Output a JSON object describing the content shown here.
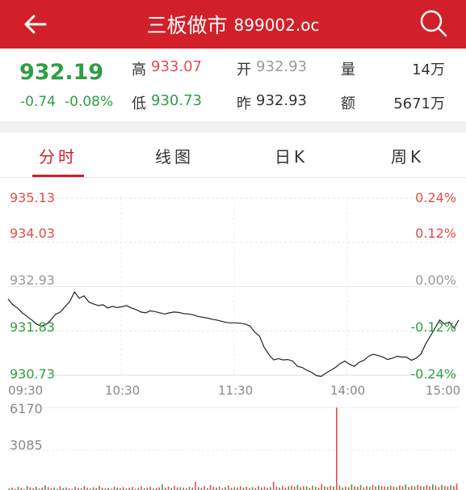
{
  "header": {
    "title": "三板做市",
    "code": "899002.oc"
  },
  "quote": {
    "price": "932.19",
    "change": "-0.74",
    "change_pct": "-0.08%",
    "high_label": "高",
    "high_value": "933.07",
    "low_label": "低",
    "low_value": "930.73",
    "open_label": "开",
    "open_value": "932.93",
    "prev_label": "昨",
    "prev_value": "932.93",
    "volume_label": "量",
    "volume_value": "14万",
    "amount_label": "额",
    "amount_value": "5671万"
  },
  "tabs": [
    "分时",
    "线图",
    "日K",
    "周K"
  ],
  "active_tab": 0,
  "chart_data": {
    "type": "line",
    "y_price_labels": [
      "935.13",
      "934.03",
      "932.93",
      "931.83",
      "930.73"
    ],
    "y_pct_labels": [
      "0.24%",
      "0.12%",
      "0.00%",
      "-0.12%",
      "-0.24%"
    ],
    "x_time_labels": [
      "09:30",
      "10:30",
      "11:30",
      "14:00",
      "15:00"
    ],
    "ylim": [
      930.73,
      935.13
    ],
    "prev_close": 932.93,
    "price_series": [
      932.62,
      932.48,
      932.4,
      932.28,
      932.19,
      932.1,
      932.0,
      931.95,
      931.99,
      932.1,
      932.24,
      932.3,
      932.43,
      932.56,
      932.8,
      932.64,
      932.7,
      932.55,
      932.5,
      932.46,
      932.48,
      932.4,
      932.44,
      932.41,
      932.43,
      932.46,
      932.4,
      932.36,
      932.3,
      932.28,
      932.33,
      932.31,
      932.28,
      932.25,
      932.28,
      932.3,
      932.29,
      932.26,
      932.25,
      932.23,
      932.19,
      932.17,
      932.15,
      932.12,
      932.1,
      932.07,
      932.04,
      932.03,
      932.03,
      932.02,
      932.0,
      931.95,
      931.8,
      931.7,
      931.42,
      931.24,
      931.11,
      931.14,
      931.11,
      931.12,
      931.08,
      930.95,
      930.92,
      930.85,
      930.8,
      930.72,
      930.7,
      930.78,
      930.85,
      930.92,
      931.02,
      931.08,
      931.0,
      930.95,
      931.05,
      931.1,
      931.2,
      931.25,
      931.22,
      931.18,
      931.12,
      931.15,
      931.2,
      931.18,
      931.18,
      931.1,
      931.15,
      931.25,
      931.5,
      931.7,
      931.9,
      932.1,
      932.0,
      932.05,
      931.9,
      932.1
    ],
    "volume_scale_labels": [
      "6170",
      "3085"
    ],
    "volume_series": [
      120,
      180,
      90,
      240,
      160,
      70,
      300,
      210,
      140,
      260,
      110,
      190,
      350,
      220,
      130,
      180,
      90,
      270,
      150,
      200,
      110,
      80,
      240,
      160,
      130,
      290,
      170,
      100,
      220,
      140,
      310,
      190,
      120,
      160,
      90,
      260,
      180,
      140,
      210,
      110,
      170,
      230,
      90,
      150,
      280,
      130,
      190,
      240,
      110,
      160,
      200,
      420,
      180,
      260,
      140,
      310,
      190,
      220,
      160,
      130,
      250,
      180,
      600,
      210,
      160,
      290,
      140,
      380,
      230,
      180,
      260,
      120,
      220,
      340,
      160,
      210,
      190,
      280,
      170,
      240,
      130,
      210,
      160,
      300,
      190,
      250,
      170,
      220,
      610,
      260,
      190,
      310,
      180,
      280,
      330,
      240,
      370,
      210,
      290,
      280,
      160,
      320,
      250,
      190,
      460,
      280,
      220,
      310,
      260,
      6170,
      330,
      190,
      260,
      210,
      410,
      280,
      240,
      360,
      200,
      290,
      230,
      380,
      270,
      350,
      300,
      270,
      240,
      320,
      260,
      210,
      340,
      290,
      410,
      230,
      310,
      270,
      380,
      300,
      250,
      360,
      280,
      420,
      330,
      220,
      390,
      300,
      260,
      350,
      290,
      480
    ]
  },
  "colors": {
    "brand": "#d2202a",
    "up": "#e34c4c",
    "down": "#2e9f43"
  }
}
